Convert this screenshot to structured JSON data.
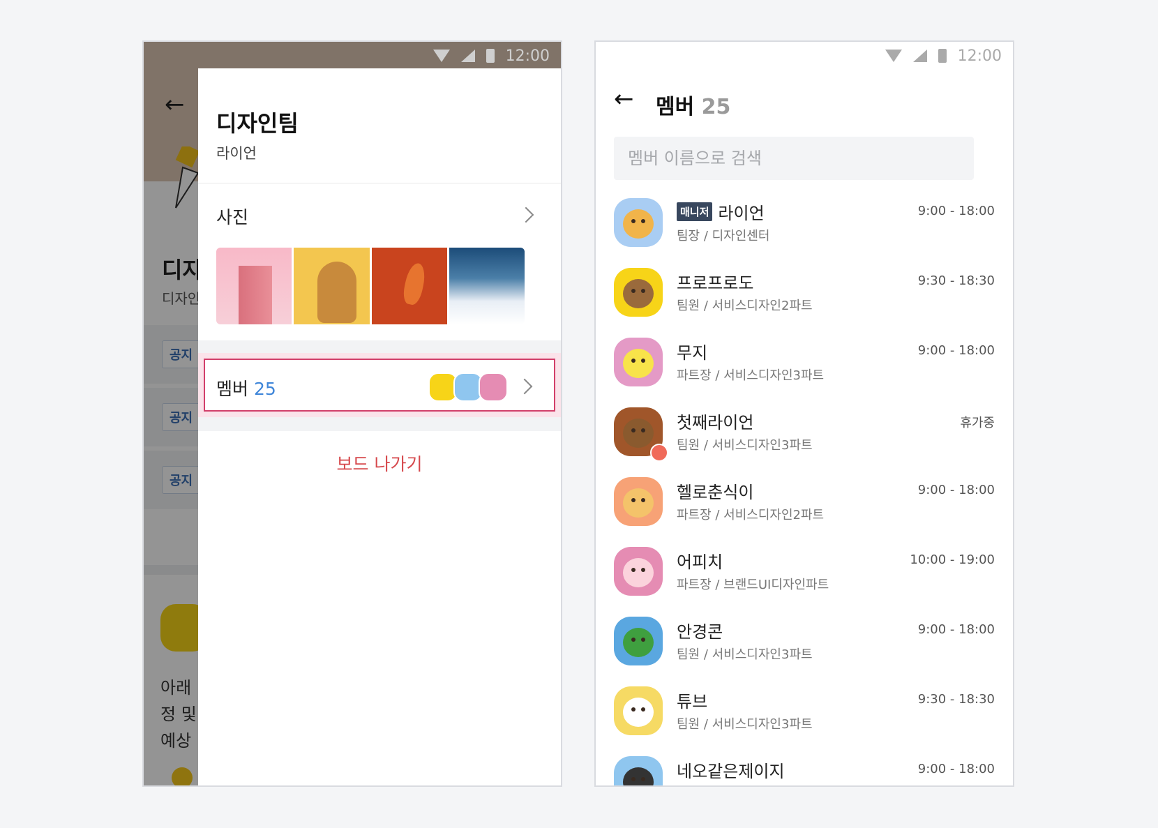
{
  "status_time": "12:00",
  "left": {
    "background": {
      "title": "디자",
      "subtitle": "디자인",
      "notices": [
        "공지",
        "공지",
        "공지"
      ],
      "text_lines": [
        "아래",
        "정 및",
        "예상"
      ]
    },
    "drawer": {
      "title": "디자인팀",
      "owner": "라이언",
      "photos_label": "사진",
      "member_label": "멤버",
      "member_count": "25",
      "leave_label": "보드 나가기"
    }
  },
  "right": {
    "header": {
      "title": "멤버",
      "count": "25"
    },
    "search": {
      "placeholder": "멤버 이름으로 검색"
    },
    "members": [
      {
        "name": "라이언",
        "badge": "매니저",
        "role": "팀장 / 디자인센터",
        "time": "9:00 - 18:00",
        "color": "#a9cdf3",
        "face": "#f1b44a"
      },
      {
        "name": "프로프로도",
        "badge": "",
        "role": "팀원 / 서비스디자인2파트",
        "time": "9:30 - 18:30",
        "color": "#f7d418",
        "face": "#9a6a3c"
      },
      {
        "name": "무지",
        "badge": "",
        "role": "파트장 / 서비스디자인3파트",
        "time": "9:00 - 18:00",
        "color": "#e49ac6",
        "face": "#f8e34a"
      },
      {
        "name": "첫째라이언",
        "badge": "",
        "role": "팀원 / 서비스디자인3파트",
        "time": "휴가중",
        "color": "#a0562a",
        "face": "#8a5a2e"
      },
      {
        "name": "헬로춘식이",
        "badge": "",
        "role": "파트장 / 서비스디자인2파트",
        "time": "9:00 - 18:00",
        "color": "#f7a276",
        "face": "#f4c36a"
      },
      {
        "name": "어피치",
        "badge": "",
        "role": "파트장 / 브랜드UI디자인파트",
        "time": "10:00 - 19:00",
        "color": "#e58cb3",
        "face": "#fbd3dc"
      },
      {
        "name": "안경콘",
        "badge": "",
        "role": "팀원 / 서비스디자인3파트",
        "time": "9:00 - 18:00",
        "color": "#5aa7e0",
        "face": "#3f9f3f"
      },
      {
        "name": "튜브",
        "badge": "",
        "role": "팀원 / 서비스디자인3파트",
        "time": "9:30 - 18:30",
        "color": "#f6da64",
        "face": "#ffffff"
      },
      {
        "name": "네오같은제이지",
        "badge": "",
        "role": "",
        "time": "9:00 - 18:00",
        "color": "#8fc6ef",
        "face": "#333333"
      }
    ]
  }
}
